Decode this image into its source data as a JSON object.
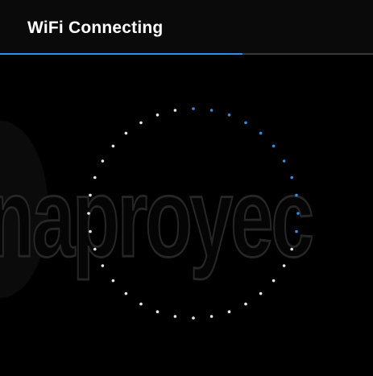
{
  "header": {
    "title": "WiFi Connecting"
  },
  "progress": {
    "fraction": 0.65,
    "color": "#2f8fe6",
    "track_color": "#3a3a3a"
  },
  "spinner": {
    "dot_count": 36,
    "active_dots": 11,
    "active_color": "#2f8fe6",
    "idle_color": "#e8e8e8"
  },
  "watermark": {
    "text": "naproyec"
  }
}
